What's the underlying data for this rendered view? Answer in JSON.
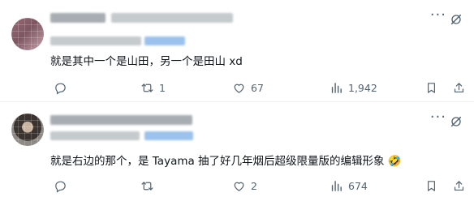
{
  "tweets": [
    {
      "text": "就是其中一个是山田，另一个是田山 xd",
      "replies": "",
      "retweets": "1",
      "likes": "67",
      "views": "1,942"
    },
    {
      "text": "就是右边的那个，是 Tayama 抽了好几年烟后超级限量版的编辑形象 🤣",
      "replies": "",
      "retweets": "",
      "likes": "2",
      "views": "674"
    }
  ],
  "icons": {
    "more": "more-options-icon",
    "grok": "grok-icon",
    "reply": "reply-icon",
    "retweet": "retweet-icon",
    "like": "like-icon",
    "views": "views-icon",
    "bookmark": "bookmark-icon",
    "share": "share-icon"
  },
  "colors": {
    "secondary_text": "#536471",
    "divider": "#eff3f4",
    "primary_text": "#0f1419"
  }
}
